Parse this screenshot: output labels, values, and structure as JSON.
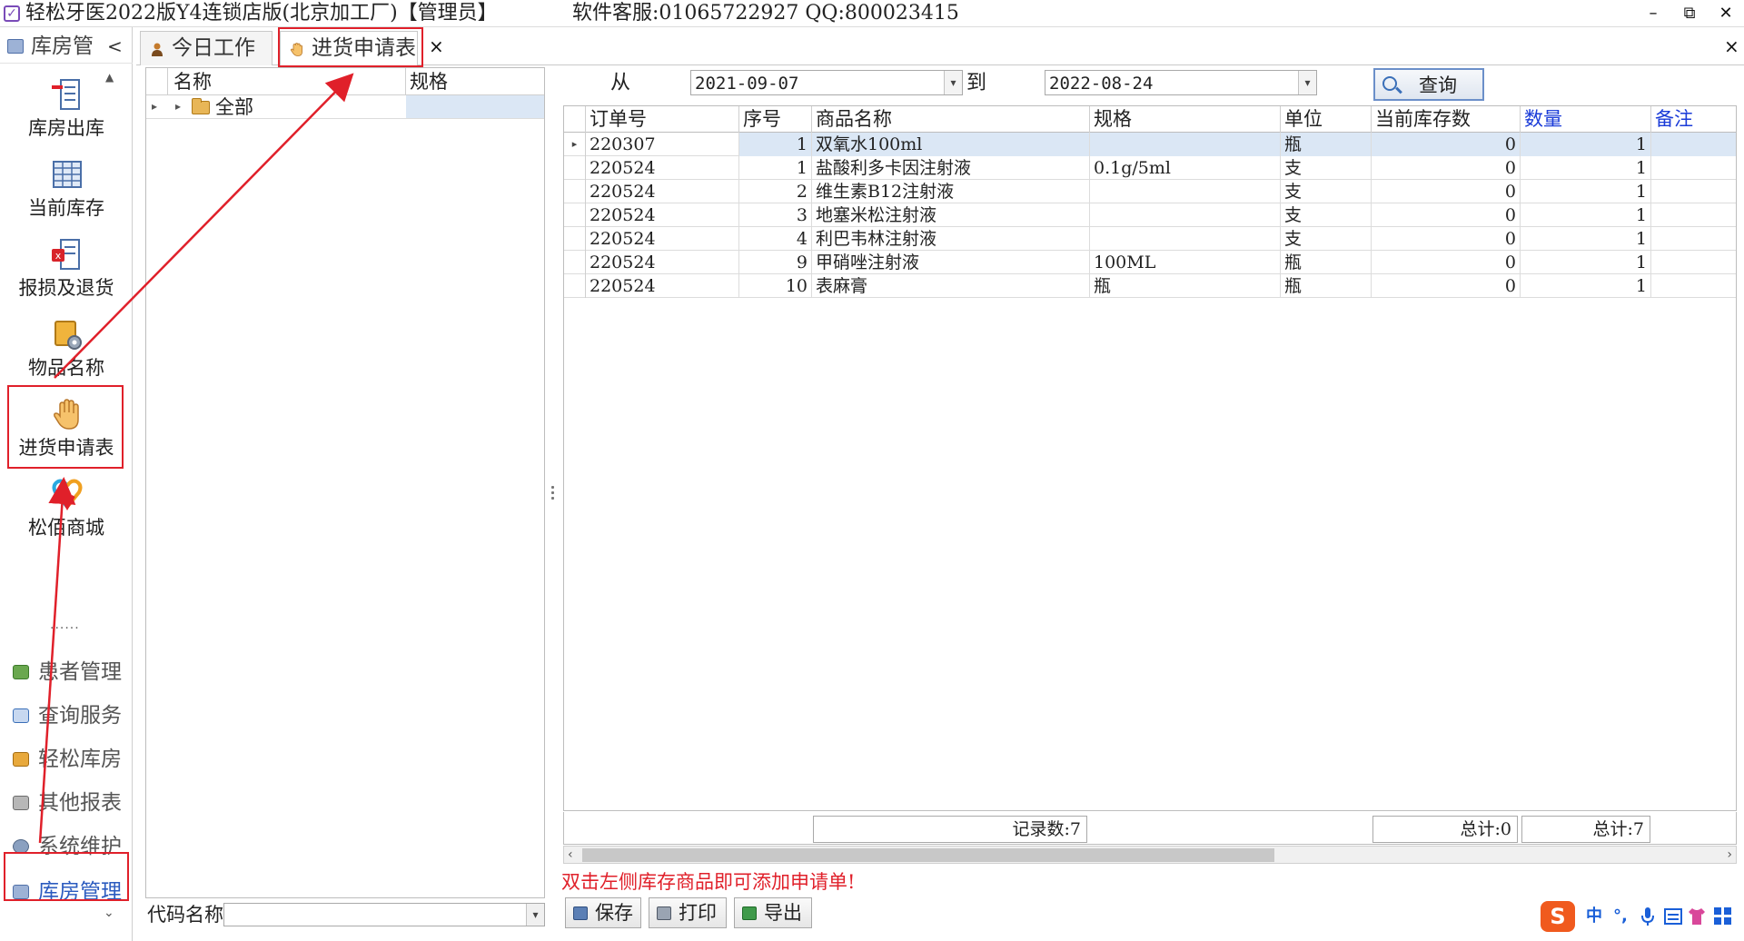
{
  "window": {
    "title": "轻松牙医2022版Y4连锁店版(北京加工厂)【管理员】",
    "service": "软件客服:01065722927 QQ:800023415",
    "minimize": "–",
    "restore": "⧉",
    "close": "✕"
  },
  "sidebar": {
    "header_label": "库房管",
    "collapse": "<",
    "tools": [
      {
        "label": "库房出库",
        "icon": "outbound-icon"
      },
      {
        "label": "当前库存",
        "icon": "inventory-grid-icon"
      },
      {
        "label": "报损及退货",
        "icon": "loss-return-icon"
      },
      {
        "label": "物品名称",
        "icon": "item-settings-icon"
      },
      {
        "label": "进货申请表",
        "icon": "hand-icon"
      },
      {
        "label": "松佰商城",
        "icon": "mall-icon"
      }
    ],
    "separator": "......",
    "nav": [
      {
        "label": "患者管理"
      },
      {
        "label": "查询服务"
      },
      {
        "label": "轻松库房"
      },
      {
        "label": "其他报表"
      },
      {
        "label": "系统维护"
      },
      {
        "label": "库房管理"
      }
    ]
  },
  "tabs": [
    {
      "label": "今日工作"
    },
    {
      "label": "进货申请表"
    }
  ],
  "tab_close": "×",
  "strip_close": "×",
  "tree": {
    "col_name": "名称",
    "col_spec": "规格",
    "root_node": "全部"
  },
  "code_filter": {
    "label": "代码名称",
    "value": ""
  },
  "filters": {
    "from_label": "从",
    "from_date": "2021-09-07",
    "to_label": "到",
    "to_date": "2022-08-24",
    "query_label": "查询"
  },
  "grid": {
    "columns": [
      "订单号",
      "序号",
      "商品名称",
      "规格",
      "单位",
      "当前库存数",
      "数量",
      "备注"
    ],
    "rows": [
      [
        "220307",
        "1",
        "双氧水100ml",
        "",
        "瓶",
        "0",
        "1",
        ""
      ],
      [
        "220524",
        "1",
        "盐酸利多卡因注射液",
        "0.1g/5ml",
        "支",
        "0",
        "1",
        ""
      ],
      [
        "220524",
        "2",
        "维生素B12注射液",
        "",
        "支",
        "0",
        "1",
        ""
      ],
      [
        "220524",
        "3",
        "地塞米松注射液",
        "",
        "支",
        "0",
        "1",
        ""
      ],
      [
        "220524",
        "4",
        "利巴韦林注射液",
        "",
        "支",
        "0",
        "1",
        ""
      ],
      [
        "220524",
        "9",
        "甲硝唑注射液",
        "100ML",
        "瓶",
        "0",
        "1",
        ""
      ],
      [
        "220524",
        "10",
        "表麻膏",
        "瓶",
        "瓶",
        "0",
        "1",
        ""
      ]
    ]
  },
  "summary": {
    "record_count": "记录数:7",
    "total_stock": "总计:0",
    "total_qty": "总计:7"
  },
  "hint": "双击左侧库存商品即可添加申请单!",
  "actions": {
    "save": "保存",
    "print": "打印",
    "export": "导出"
  },
  "ime": {
    "logo": "S",
    "mode": "中"
  },
  "colors": {
    "annotation_red": "#e0202a",
    "header_blue": "#1a3bd8",
    "selection": "#dbe7f5"
  }
}
